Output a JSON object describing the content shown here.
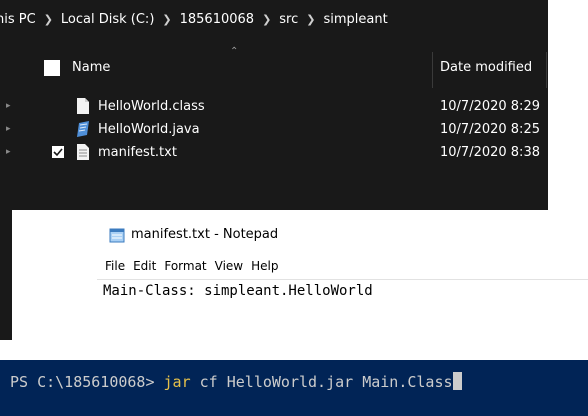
{
  "explorer": {
    "breadcrumb": [
      "his PC",
      "Local Disk (C:)",
      "185610068",
      "src",
      "simpleant"
    ],
    "columns": {
      "name": "Name",
      "date_modified": "Date modified"
    },
    "files": [
      {
        "name": "HelloWorld.class",
        "date": "10/7/2020 8:29",
        "icon": "file-icon",
        "checked": false
      },
      {
        "name": "HelloWorld.java",
        "date": "10/7/2020 8:25",
        "icon": "java-file-icon",
        "checked": false
      },
      {
        "name": "manifest.txt",
        "date": "10/7/2020 8:38",
        "icon": "text-file-icon",
        "checked": true
      }
    ]
  },
  "notepad": {
    "title": "manifest.txt - Notepad",
    "menu": [
      "File",
      "Edit",
      "Format",
      "View",
      "Help"
    ],
    "content": "Main-Class: simpleant.HelloWorld"
  },
  "powershell": {
    "prompt": "PS C:\\185610068> ",
    "command": "jar",
    "args": " cf HelloWorld.jar Main.Class"
  },
  "colors": {
    "explorer_bg": "#191919",
    "powershell_bg": "#012456",
    "command_yellow": "#e5c04a"
  }
}
